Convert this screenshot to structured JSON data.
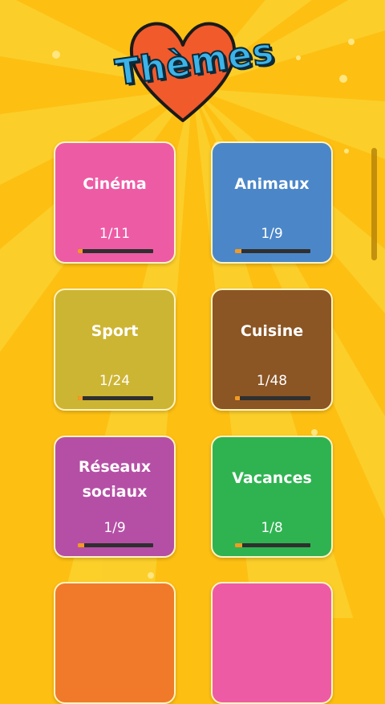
{
  "header": {
    "title": "Thèmes"
  },
  "colors": {
    "background": "#FDBF12",
    "heart": "#F15A2B",
    "title": "#3CB4EA",
    "progress_fill": "#F39A22",
    "progress_track": "#2f2f2f"
  },
  "themes": [
    {
      "name": "Cinéma",
      "progress": "1/11",
      "done": 1,
      "total": 11,
      "color": "#EE5BA5"
    },
    {
      "name": "Animaux",
      "progress": "1/9",
      "done": 1,
      "total": 9,
      "color": "#4B87C8"
    },
    {
      "name": "Sport",
      "progress": "1/24",
      "done": 1,
      "total": 24,
      "color": "#CDB534"
    },
    {
      "name": "Cuisine",
      "progress": "1/48",
      "done": 1,
      "total": 48,
      "color": "#8B5524"
    },
    {
      "name": "Réseaux\nsociaux",
      "progress": "1/9",
      "done": 1,
      "total": 9,
      "color": "#B54FA5"
    },
    {
      "name": "Vacances",
      "progress": "1/8",
      "done": 1,
      "total": 8,
      "color": "#2FB351"
    },
    {
      "name": "",
      "progress": "",
      "done": 0,
      "total": 0,
      "color": "#F07A2A"
    },
    {
      "name": "",
      "progress": "",
      "done": 0,
      "total": 0,
      "color": "#EE5BA5"
    }
  ]
}
